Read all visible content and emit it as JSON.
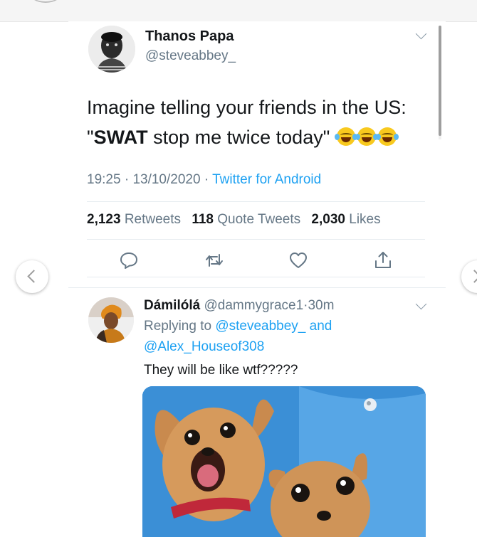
{
  "tweet": {
    "author_name": "Thanos Papa",
    "author_handle": "@steveabbey_",
    "text_before": "Imagine telling your friends in the US:",
    "text_quote_open": "\"",
    "text_bold": "SWAT",
    "text_after": " stop me twice today\"",
    "emoji": [
      "face-with-tears-of-joy",
      "face-with-tears-of-joy",
      "face-with-tears-of-joy"
    ],
    "time": "19:25",
    "date": "13/10/2020",
    "separator": "·",
    "source": "Twitter for Android",
    "retweets": "2,123",
    "retweets_label": "Retweets",
    "quotes": "118",
    "quotes_label": "Quote Tweets",
    "likes": "2,030",
    "likes_label": "Likes"
  },
  "actions": {
    "icons": [
      "reply-icon",
      "retweet-icon",
      "like-icon",
      "share-icon"
    ]
  },
  "reply": {
    "author_name": "Dámilólá",
    "author_handle": "@dammygrace1",
    "separator": "·",
    "time_ago": "30m",
    "replying_prefix": "Replying to",
    "replying_to_1": "@steveabbey_",
    "and_word": "and",
    "replying_to_2": "@Alex_Houseof308",
    "text": "They will be like wtf?????"
  },
  "colors": {
    "accent": "#1da1f2",
    "secondary_text": "#657786",
    "primary_text": "#14171a",
    "emoji_yellow": "#f8c91e",
    "media_blue": "#3b8fd6"
  }
}
